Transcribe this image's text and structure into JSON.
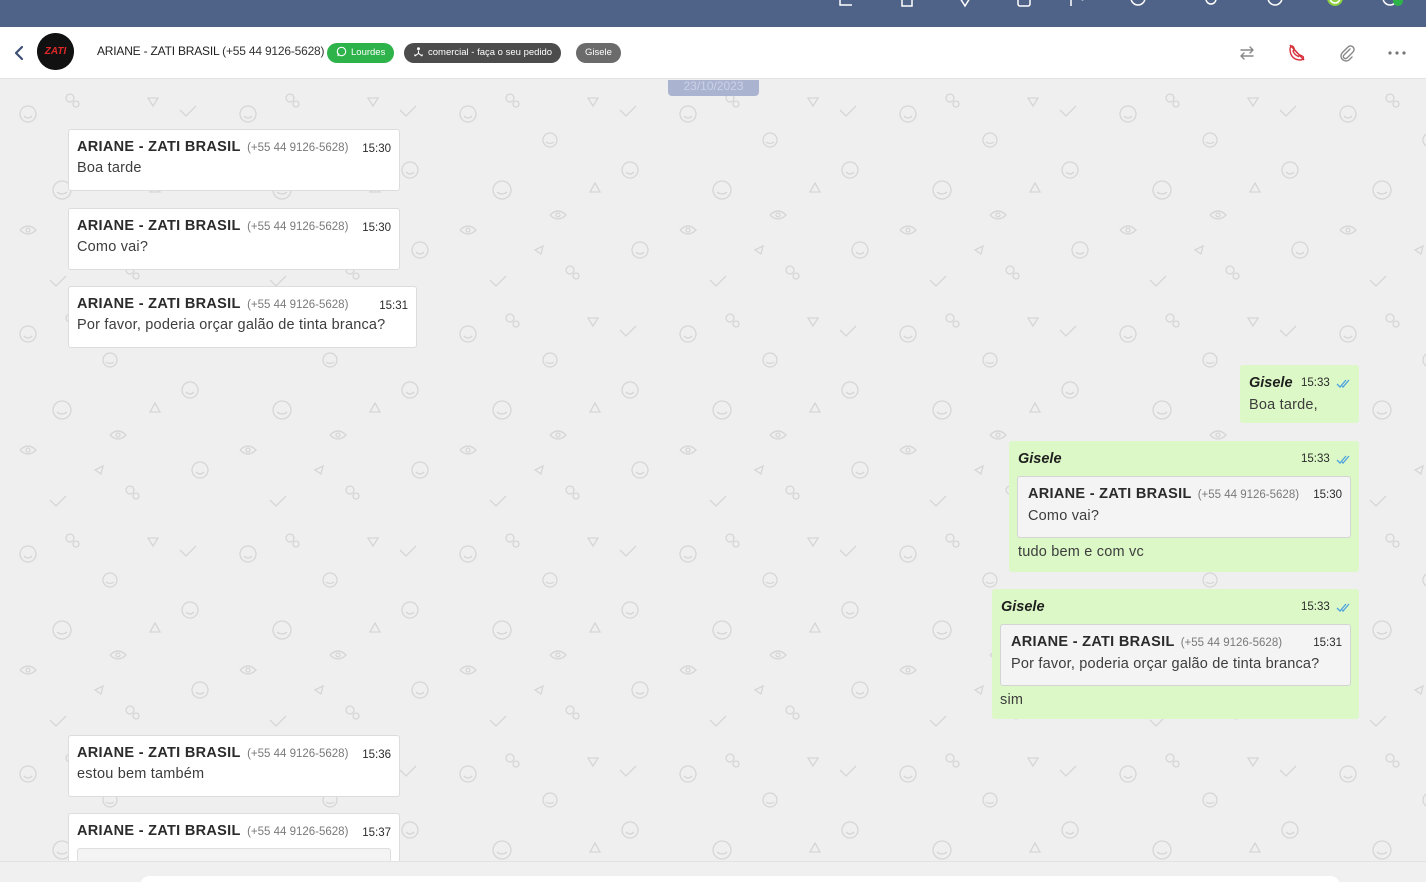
{
  "topbar": {
    "icons": [
      "chart-icon",
      "document-icon",
      "location-icon",
      "users-icon",
      "user-add-icon",
      "clock-icon",
      "settings-icon",
      "help-icon",
      "status-online-icon",
      "notification-icon"
    ]
  },
  "header": {
    "back_icon": "chevron-left-icon",
    "contact_name": "ARIANE - ZATI BRASIL",
    "contact_phone": "(+55 44 9126-5628)",
    "avatar_text": "ZATI",
    "tags": [
      {
        "label": "Lourdes",
        "icon": "whatsapp-icon",
        "color": "#2eb34b"
      },
      {
        "label": "comercial - faça o seu pedido",
        "icon": "queue-icon",
        "color": "#4c4c4c"
      },
      {
        "label": "Gisele",
        "color": "#6b6b6b"
      }
    ],
    "actions": [
      "transfer-icon",
      "end-call-icon",
      "attach-icon",
      "more-icon"
    ]
  },
  "chat": {
    "date": "23/10/2023",
    "incoming": [
      {
        "sender": "ARIANE - ZATI BRASIL",
        "phone": "(+55 44 9126-5628)",
        "time": "15:30",
        "text": "Boa tarde"
      },
      {
        "sender": "ARIANE - ZATI BRASIL",
        "phone": "(+55 44 9126-5628)",
        "time": "15:30",
        "text": "Como vai?"
      },
      {
        "sender": "ARIANE - ZATI BRASIL",
        "phone": "(+55 44 9126-5628)",
        "time": "15:31",
        "text": "Por favor, poderia orçar galão de tinta branca?"
      },
      {
        "sender": "ARIANE - ZATI BRASIL",
        "phone": "(+55 44 9126-5628)",
        "time": "15:36",
        "text": "estou bem também"
      },
      {
        "sender": "ARIANE - ZATI BRASIL",
        "phone": "(+55 44 9126-5628)",
        "time": "15:37",
        "text": ""
      }
    ],
    "outgoing": [
      {
        "sender": "Gisele",
        "time": "15:33",
        "text": "Boa tarde,"
      },
      {
        "sender": "Gisele",
        "time": "15:33",
        "text": "tudo bem e com vc",
        "quote": {
          "sender": "ARIANE - ZATI BRASIL",
          "phone": "(+55 44 9126-5628)",
          "time": "15:30",
          "text": "Como vai?"
        }
      },
      {
        "sender": "Gisele",
        "time": "15:33",
        "text": "sim",
        "quote": {
          "sender": "ARIANE - ZATI BRASIL",
          "phone": "(+55 44 9126-5628)",
          "time": "15:31",
          "text": "Por favor, poderia orçar galão de tinta branca?"
        }
      }
    ],
    "scroll_icon": "chevron-down-icon"
  },
  "colors": {
    "topbar": "#4f6287",
    "outgoing_bubble": "#dcf8c6",
    "incoming_bubble": "#ffffff",
    "read_check": "#4fa3e0",
    "end_call": "#d6303a"
  }
}
